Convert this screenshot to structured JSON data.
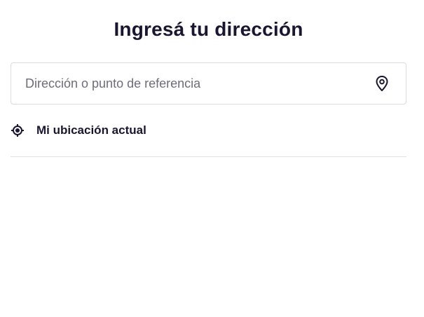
{
  "header": {
    "title": "Ingresá tu dirección"
  },
  "search": {
    "value": "",
    "placeholder": "Dirección o punto de referencia",
    "icon": "map-pin-icon"
  },
  "current_location": {
    "label": "Mi ubicación actual",
    "icon": "crosshair-target-icon"
  },
  "colors": {
    "text": "#1a1530",
    "placeholder": "#6e6c7a",
    "border": "#dcdce0",
    "divider": "#e2e2e6",
    "background": "#ffffff"
  }
}
